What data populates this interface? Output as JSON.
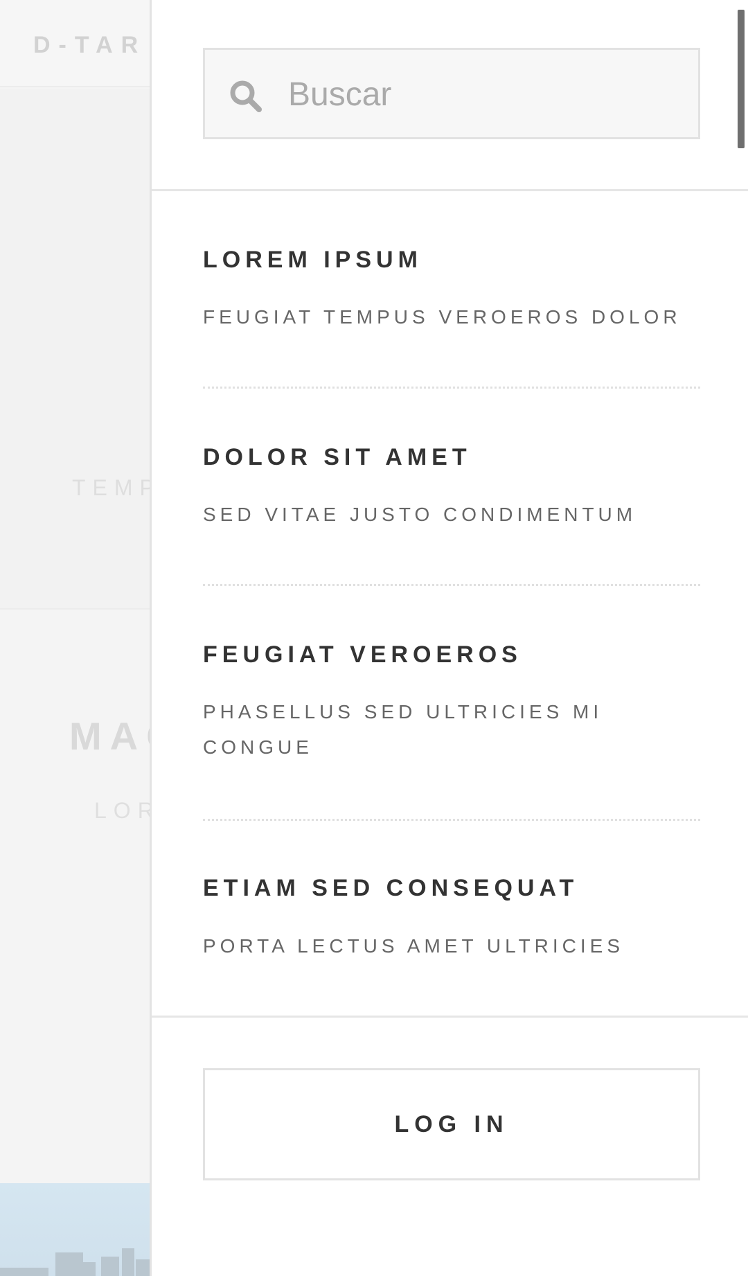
{
  "background": {
    "logo": "D-TAR",
    "banner_text": "TEMP",
    "section_title": "MAG",
    "section_subtitle": "LOR"
  },
  "search": {
    "placeholder": "Buscar",
    "value": ""
  },
  "menu": {
    "items": [
      {
        "title": "LOREM IPSUM",
        "subtitle": "FEUGIAT TEMPUS VEROEROS DOLOR"
      },
      {
        "title": "DOLOR SIT AMET",
        "subtitle": "SED VITAE JUSTO CONDIMENTUM"
      },
      {
        "title": "FEUGIAT VEROEROS",
        "subtitle": "PHASELLUS SED ULTRICIES MI CONGUE"
      },
      {
        "title": "ETIAM SED CONSEQUAT",
        "subtitle": "PORTA LECTUS AMET ULTRICIES"
      }
    ]
  },
  "login": {
    "label": "LOG IN"
  }
}
